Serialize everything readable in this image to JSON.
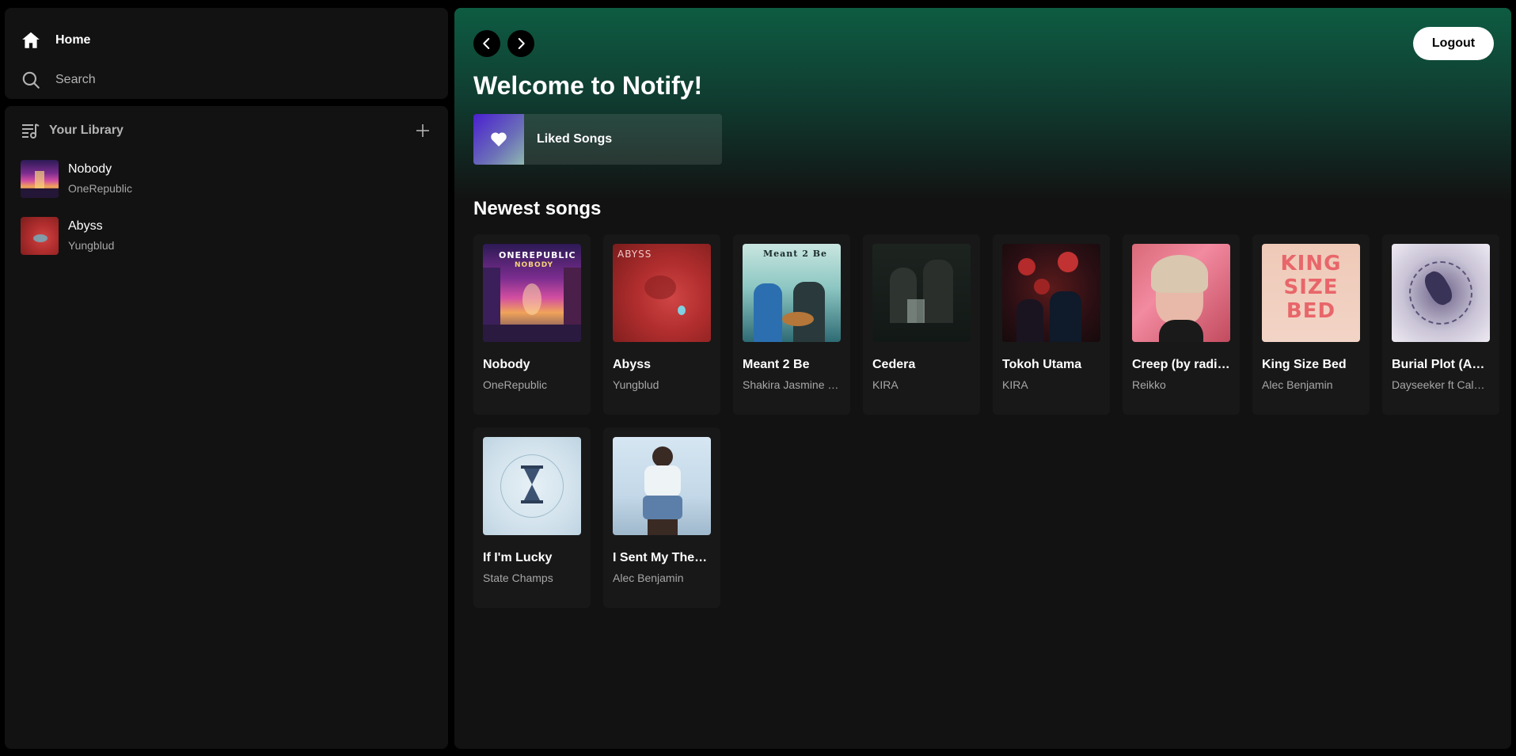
{
  "nav": {
    "home_label": "Home",
    "search_label": "Search"
  },
  "library": {
    "title": "Your Library",
    "items": [
      {
        "title": "Nobody",
        "artist": "OneRepublic"
      },
      {
        "title": "Abyss",
        "artist": "Yungblud"
      }
    ]
  },
  "header": {
    "logout_label": "Logout",
    "welcome": "Welcome to Notify!",
    "liked_label": "Liked Songs"
  },
  "newest": {
    "title": "Newest songs",
    "songs": [
      {
        "title": "Nobody",
        "artist": "OneRepublic"
      },
      {
        "title": "Abyss",
        "artist": "Yungblud"
      },
      {
        "title": "Meant 2 Be",
        "artist": "Shakira Jasmine & Feby Putri"
      },
      {
        "title": "Cedera",
        "artist": "KIRA"
      },
      {
        "title": "Tokoh Utama",
        "artist": "KIRA"
      },
      {
        "title": "Creep (by radiohead)",
        "artist": "Reikko"
      },
      {
        "title": "King Size Bed",
        "artist": "Alec Benjamin"
      },
      {
        "title": "Burial Plot (Acoustic)",
        "artist": "Dayseeker ft Caleb Shomo"
      },
      {
        "title": "If I'm Lucky",
        "artist": "State Champs"
      },
      {
        "title": "I Sent My Therapist To Therapy",
        "artist": "Alec Benjamin"
      }
    ]
  },
  "cover_text": {
    "nobody": "ONEREPUBLIC",
    "nobody_sub": "NOBODY",
    "abyss": "ABYSS",
    "meant": "Meant 2 Be",
    "king": "KING SIZE BED"
  },
  "colors": {
    "accent_green": "#0e5c42",
    "panel": "#121212",
    "card": "#181818",
    "muted_text": "#a7a7a7"
  }
}
